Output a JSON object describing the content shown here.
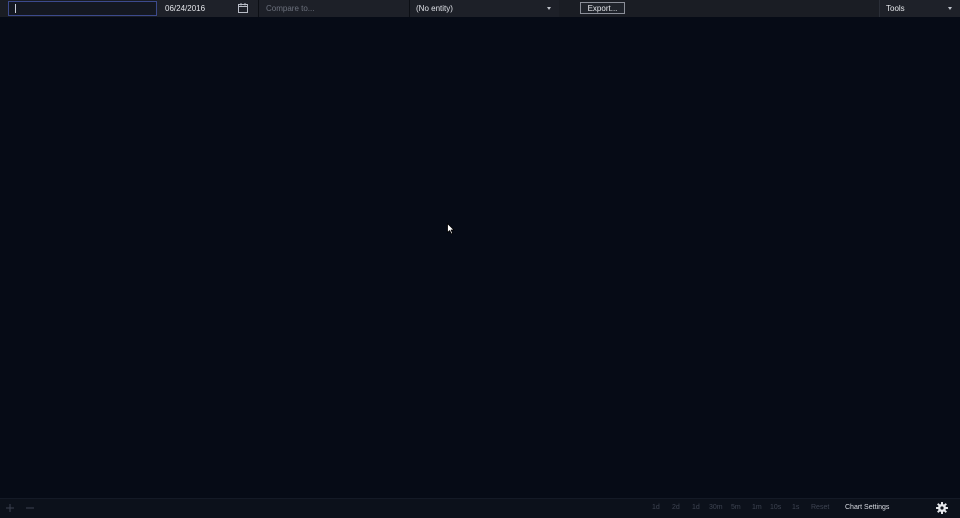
{
  "toolbar": {
    "symbol_input_value": "",
    "date_value": "06/24/2016",
    "compare_placeholder": "Compare to...",
    "entity_selected": "(No entity)",
    "export_label": "Export...",
    "tools_label": "Tools"
  },
  "footer": {
    "zoom_in_icon": "plus-icon",
    "zoom_out_icon": "minus-icon",
    "ranges": [
      "1d",
      "2d",
      "1d",
      "30m",
      "5m",
      "1m",
      "10s",
      "1s",
      "Reset"
    ],
    "chart_settings_label": "Chart Settings",
    "settings_icon": "gear-icon"
  },
  "colors": {
    "background": "#060b16",
    "toolbar": "#1a1d24",
    "focus_border": "#3c4a8c",
    "disabled_text": "#3e4452"
  }
}
